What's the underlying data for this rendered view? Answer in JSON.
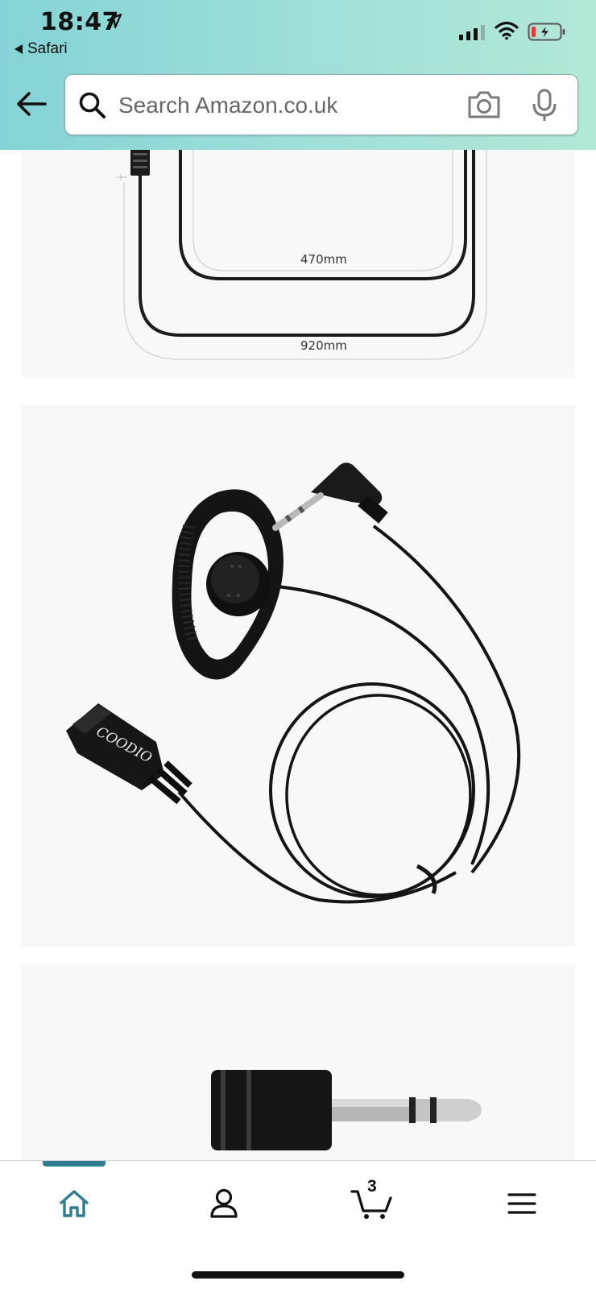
{
  "status_bar": {
    "time": "18:47",
    "back_app": "Safari"
  },
  "search": {
    "placeholder": "Search Amazon.co.uk"
  },
  "product_images": {
    "dimension_short": "470mm",
    "dimension_long": "920mm",
    "brand_text": "COODIO"
  },
  "tabbar": {
    "cart_count": "3",
    "active_tab": "home"
  },
  "colors": {
    "header_gradient_start": "#84d3d6",
    "header_gradient_end": "#b2e8d6",
    "active_tab": "#2e7d90"
  }
}
